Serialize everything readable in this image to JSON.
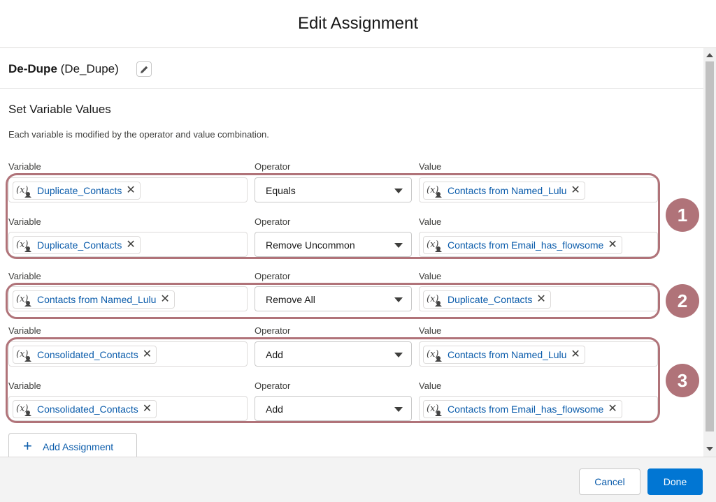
{
  "modal": {
    "title": "Edit Assignment"
  },
  "element": {
    "label": "De-Dupe",
    "api_name": "(De_Dupe)"
  },
  "section": {
    "title": "Set Variable Values",
    "description": "Each variable is modified by the operator and value combination."
  },
  "labels": {
    "variable": "Variable",
    "operator": "Operator",
    "value": "Value"
  },
  "rows": [
    {
      "variable": "Duplicate_Contacts",
      "operator": "Equals",
      "value": "Contacts from Named_Lulu"
    },
    {
      "variable": "Duplicate_Contacts",
      "operator": "Remove Uncommon",
      "value": "Contacts from Email_has_flowsome"
    },
    {
      "variable": "Contacts from Named_Lulu",
      "operator": "Remove All",
      "value": "Duplicate_Contacts"
    },
    {
      "variable": "Consolidated_Contacts",
      "operator": "Add",
      "value": "Contacts from Named_Lulu"
    },
    {
      "variable": "Consolidated_Contacts",
      "operator": "Add",
      "value": "Contacts from Email_has_flowsome"
    }
  ],
  "badges": [
    "1",
    "2",
    "3"
  ],
  "add_assignment_label": "Add Assignment",
  "footer": {
    "cancel_label": "Cancel",
    "done_label": "Done"
  },
  "colors": {
    "brand": "#0176d3",
    "link": "#0b5cab",
    "annotation": "#b07379"
  },
  "icons": {
    "variable": "variable-icon",
    "remove": "close-icon",
    "edit": "pencil-icon",
    "add": "plus-icon"
  }
}
